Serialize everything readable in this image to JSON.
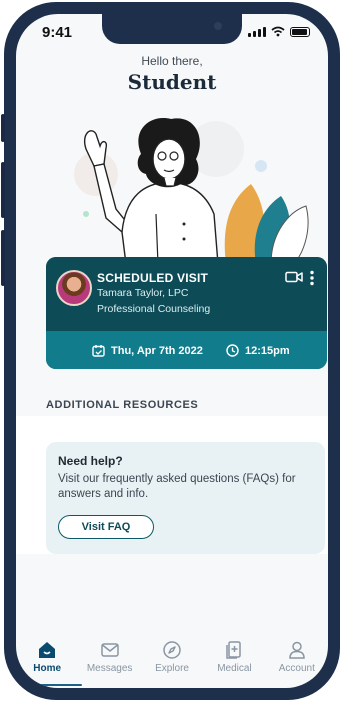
{
  "status_bar": {
    "time": "9:41"
  },
  "header": {
    "greeting": "Hello there,",
    "name": "Student"
  },
  "visit": {
    "title": "SCHEDULED VISIT",
    "provider": "Tamara Taylor, LPC",
    "service": "Professional Counseling",
    "date": "Thu, Apr 7th 2022",
    "time": "12:15pm"
  },
  "resources": {
    "heading": "ADDITIONAL RESOURCES",
    "help_card": {
      "title": "Need help?",
      "body": "Visit our frequently asked questions (FAQs) for answers and info.",
      "button": "Visit FAQ"
    }
  },
  "tabs": [
    {
      "label": "Home",
      "icon": "home-icon",
      "active": true
    },
    {
      "label": "Messages",
      "icon": "mail-icon",
      "active": false
    },
    {
      "label": "Explore",
      "icon": "compass-icon",
      "active": false
    },
    {
      "label": "Medical",
      "icon": "medical-icon",
      "active": false
    },
    {
      "label": "Account",
      "icon": "user-icon",
      "active": false
    }
  ],
  "colors": {
    "card_dark": "#0d4b57",
    "card_band": "#117d8c",
    "help_bg": "#e8f2f4",
    "active_tab": "#0b4a6f",
    "phone_frame": "#1d2f4a"
  }
}
